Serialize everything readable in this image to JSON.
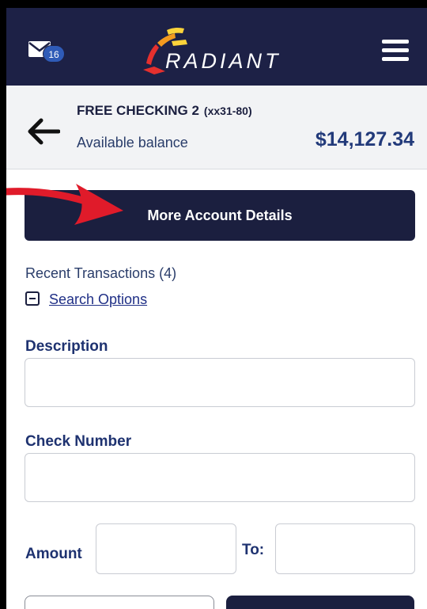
{
  "header": {
    "mail_badge": "16",
    "logo_text": "RADIANT",
    "colors": {
      "bar": "#1d2146",
      "logo_red": "#e5302e",
      "logo_orange": "#f39a1e",
      "logo_yellow": "#fbd33a"
    }
  },
  "account": {
    "name": "FREE CHECKING 2",
    "mask": "(xx31-80)",
    "available_label": "Available balance",
    "balance": "$14,127.34"
  },
  "main": {
    "more_details_label": "More Account Details",
    "recent_label": "Recent Transactions (4)",
    "search_options_label": "Search Options",
    "description_label": "Description",
    "description_value": "",
    "check_number_label": "Check Number",
    "check_number_value": "",
    "amount_label": "Amount",
    "amount_from_value": "",
    "to_label": "To:",
    "amount_to_value": ""
  },
  "annotation": {
    "arrow_color": "#e01b2a"
  }
}
